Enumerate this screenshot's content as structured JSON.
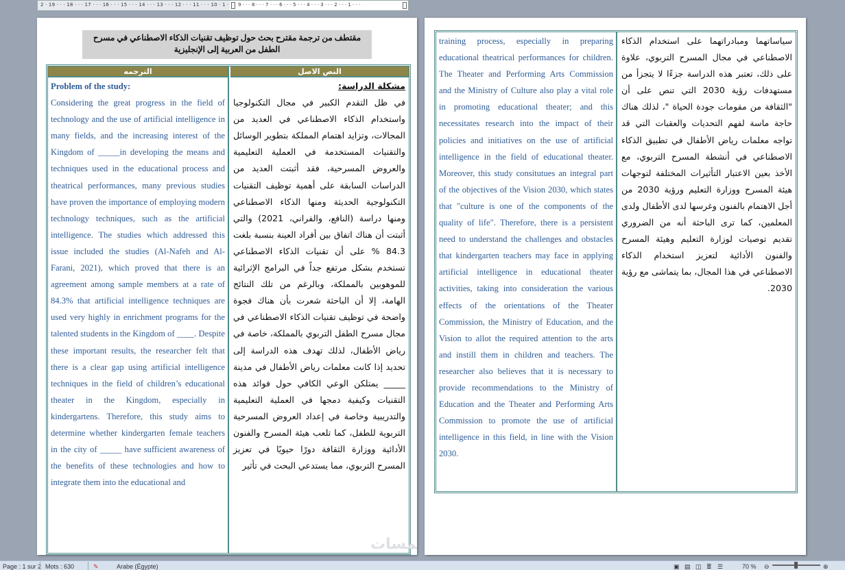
{
  "ruler": {
    "left_numbers": "2 · 19 · · · 18 · · · 17 · · · 16 · · · 15 · · · 14 · · · 13 · · · 12 · · · 11 · · · 10 · 1 ·",
    "right_numbers": "9 · · · 8 · · · 7 · · · 6 · · · 5 · · · 4 · · · 3 · · · 2 · · · 1 · · ·"
  },
  "doc_title": "مقتطف من ترجمة مقترح بحث حول توظيف تقنيات الذكاء الاصطناعي في مسرح الطفل من العربية إلى الإنجليزية",
  "table": {
    "header_translation": "الترجمه",
    "header_original": "النص الاصل"
  },
  "page1": {
    "en_heading": "Problem of the study:",
    "en_body": "Considering the great progress in the field of technology and the use of artificial intelligence in many fields, and the increasing interest of the Kingdom of _____in developing the means and techniques used in the educational process and theatrical performances, many previous studies have proven the importance of employing modern technology techniques, such as the artificial intelligence. The studies which addressed this issue included the studies (Al-Nafeh and Al-Farani, 2021), which proved that there is an agreement among sample members at a rate of 84.3% that artificial intelligence techniques are used very highly in enrichment programs for the talented students in the Kingdom of ____. Despite these important results, the researcher felt that there is a clear gap using artificial intelligence techniques in the field of children’s educational theater in the Kingdom, especially in kindergartens. Therefore, this study aims to determine whether kindergarten female teachers in the city of _____ have sufficient awareness of the benefits of these technologies and how to integrate them into the educational and",
    "ar_heading": "مشكلة الدراسة:",
    "ar_body": "في ظل التقدم الكبير في مجال التكنولوجيا واستخدام الذكاء الاصطناعي في العديد من المجالات، وتزايد اهتمام المملكة بتطوير الوسائل والتقنيات المستخدمة في العملية التعليمية والعروض المسرحية، فقد أثبتت العديد من الدراسات السابقة على أهمية توظيف التقنيات التكنولوجية الحديثة ومنها الذكاء الاصطناعي ومنها دراسة (النافع، والفراني، 2021) والتي أثبتت أن هناك اتفاق بين أفراد العينة بنسبة بلغت 84.3 % على أن تقنيات الذكاء الاصطناعي تستخدم بشكل مرتفع جداً في البرامج الإثرائية للموهوبين بالمملكة، وبالرغم من تلك النتائج الهامة، إلا أن الباحثة شعرت بأن هناك فجوة واضحة في توظيف تقنيات الذكاء الاصطناعي في مجال مسرح الطفل التربوي بالمملكة، خاصة في رياض الأطفال، لذلك تهدف هذه الدراسة إلى تحديد إذا كانت معلمات رياض الأطفال في مدينة _____ يمتلكن الوعي الكافي حول فوائد هذه التقنيات وكيفية دمجها في العملية التعليمية والتدريبية وخاصة في إعداد العروض المسرحية التربوية للطفل، كما تلعب هيئة المسرح والفنون الأدائية ووزارة الثقافة دورًا حيويًا في تعزيز المسرح التربوي، مما يستدعي البحث في تأثير"
  },
  "page2": {
    "en_body": "training process, especially in preparing educational theatrical performances for children. The Theater and Performing Arts Commission and the Ministry of Culture also play a vital role in promoting educational theater; and this necessitates research into the impact of their policies and initiatives on the use of artificial intelligence in the field of educational theater. Moreover, this study consitutues an integral part of the objectives of the Vision 2030, which states that \"culture is one of the components of the quality of life\". Therefore, there is a persistent need to understand the challenges and obstacles that kindergarten teachers may face in applying artificial intelligence in educational theater activities, taking into consideration the various effects of the orientations of the Theater Commission, the Ministry of Education, and the Vision to allot the required attention to the arts and instill them in children and teachers. The researcher also believes that it is necessary to provide recommendations to the Ministry of Education and the Theater and Performing Arts Commission to promote the use of artificial intelligence in this field, in line with the Vision 2030.",
    "ar_body": "سياساتهما ومبادراتهما على استخدام الذكاء الاصطناعي في مجال المسرح التربوي، علاوة على ذلك، تعتبر هذه الدراسة جزءًا لا يتجزأ من مستهدفات رؤية 2030 التي تنص على أن \"الثقافة من مقومات جودة الحياة \"، لذلك هناك حاجة ماسة لفهم التحديات والعقبات التي قد تواجه معلمات رياض الأطفال في تطبيق الذكاء الاصطناعي في أنشطة المسرح التربوي، مع الأخذ بعين الاعتبار التأثيرات المختلفة لتوجهات هيئة المسرح ووزارة التعليم ورؤية 2030 من أجل الاهتمام بالفنون وغرسها لدى الأطفال ولدى المعلمين، كما ترى الباحثة أنه من الضروري تقديم توصيات لوزارة التعليم وهيئة المسرح والفنون الأدائية لتعزيز استخدام الذكاء الاصطناعي في هذا المجال، بما يتماشى مع رؤية 2030."
  },
  "status": {
    "page": "Page : 1 sur 2",
    "words": "Mots : 630",
    "language": "Arabe (Égypte)",
    "zoom": "70 %"
  },
  "watermark": "خمسات",
  "colors": {
    "english_text": "#2e5b95",
    "table_border": "#4d8a8a",
    "header_bg": "#8d8648"
  },
  "icons": [
    "spellcheck-icon",
    "print-layout-icon",
    "full-screen-icon",
    "web-layout-icon",
    "outline-icon",
    "draft-icon",
    "zoom-out-icon",
    "zoom-in-icon"
  ]
}
